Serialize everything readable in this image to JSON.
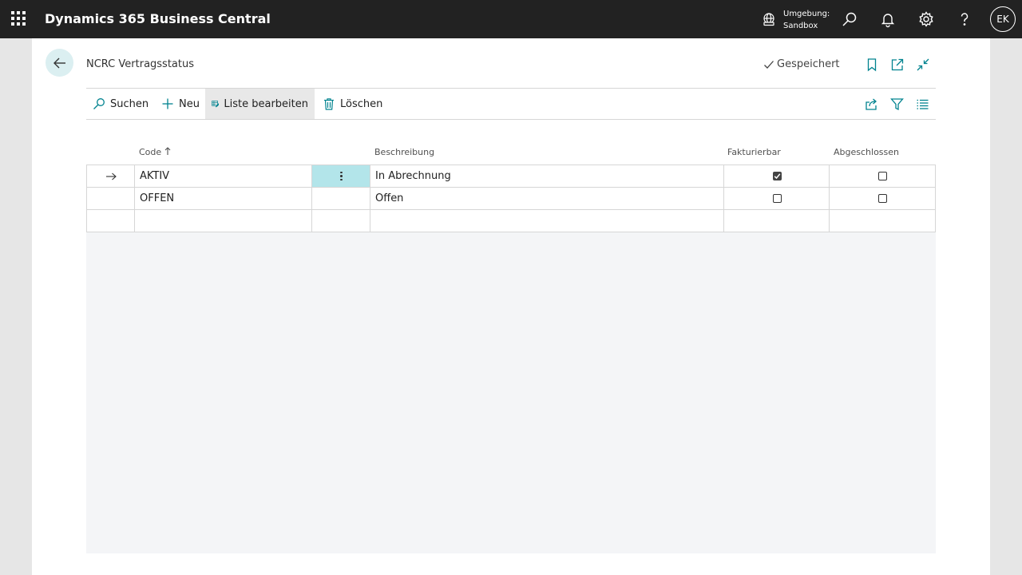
{
  "topbar": {
    "app_title": "Dynamics 365 Business Central",
    "environment_label": "Umgebung:",
    "environment_value": "Sandbox",
    "avatar_initials": "EK"
  },
  "page": {
    "title": "NCRC Vertragsstatus",
    "saved_label": "Gespeichert"
  },
  "actions": {
    "search": "Suchen",
    "new": "Neu",
    "edit_list": "Liste bearbeiten",
    "delete": "Löschen"
  },
  "table": {
    "columns": {
      "code": "Code",
      "description": "Beschreibung",
      "invoiceable": "Fakturierbar",
      "closed": "Abgeschlossen"
    },
    "rows": [
      {
        "code": "AKTIV",
        "description": "In Abrechnung",
        "invoiceable": true,
        "closed": false
      },
      {
        "code": "OFFEN",
        "description": "Offen",
        "invoiceable": false,
        "closed": false
      }
    ]
  },
  "colors": {
    "topbar_bg": "#222222",
    "accent": "#00838f",
    "selected_cell": "#b3e5ea",
    "back_button_bg": "#dbeff1"
  }
}
